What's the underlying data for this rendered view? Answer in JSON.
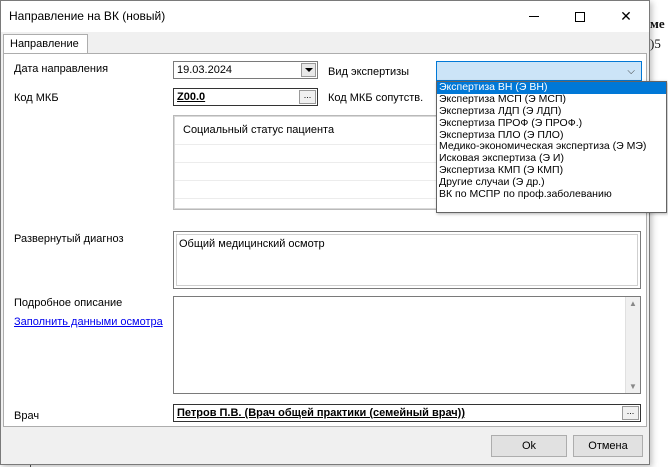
{
  "window": {
    "title": "Направление на ВК (новый)"
  },
  "background": {
    "fragment1": "ме",
    "fragment2": ")5"
  },
  "tab": {
    "label": "Направление"
  },
  "form": {
    "date_label": "Дата направления",
    "date_value": "19.03.2024",
    "expertise_label": "Вид экспертизы",
    "mkb_label": "Код МКБ",
    "mkb_value": "Z00.0",
    "mkb_assoc_label": "Код МКБ сопутств.",
    "social_status_text": "Социальный статус пациента",
    "diagnosis_label": "Развернутый диагноз",
    "diagnosis_value": "Общий медицинский осмотр",
    "description_label": "Подробное описание",
    "fill_link": "Заполнить данными осмотра",
    "doctor_label": "Врач",
    "doctor_value": "Петров П.В. (Врач общей практики (семейный врач))",
    "dots": "..."
  },
  "expertise_options": [
    "Экспертиза ВН (Э ВН)",
    "Экспертиза МСП (Э МСП)",
    "Экспертиза ЛДП (Э ЛДП)",
    "Экспертиза ПРОФ (Э ПРОФ.)",
    "Экспертиза ПЛО (Э ПЛО)",
    "Медико-экономическая экспертиза (Э МЭ)",
    "Исковая экспертиза (Э И)",
    "Экспертиза КМП (Э КМП)",
    "Другие случаи (Э др.)",
    "ВК по МСПР по проф.заболеванию"
  ],
  "expertise_selected_index": 0,
  "footer": {
    "ok_label": "Ok",
    "cancel_label": "Отмена"
  },
  "colors": {
    "accent": "#0078d7",
    "link": "#0000ee",
    "selected_bg": "#cce4f7"
  }
}
